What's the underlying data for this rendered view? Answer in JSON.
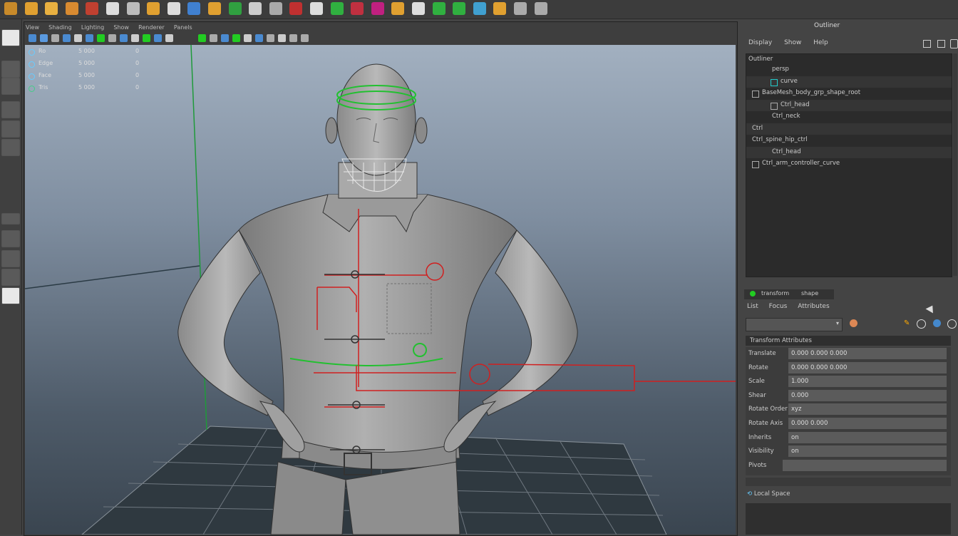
{
  "shelf": {
    "icons": [
      {
        "name": "shelf-icon-1",
        "color": "#c88a2a"
      },
      {
        "name": "shelf-icon-2",
        "color": "#e0a030"
      },
      {
        "name": "shelf-icon-3",
        "color": "#e8b040"
      },
      {
        "name": "shelf-icon-4",
        "color": "#d88a30"
      },
      {
        "name": "shelf-icon-5",
        "color": "#c04030"
      },
      {
        "name": "shelf-icon-6",
        "color": "#ddd"
      },
      {
        "name": "shelf-icon-7",
        "color": "#bbb"
      },
      {
        "name": "shelf-icon-8",
        "color": "#e0a030"
      },
      {
        "name": "shelf-icon-9",
        "color": "#ddd"
      },
      {
        "name": "shelf-icon-10",
        "color": "#4080d0"
      },
      {
        "name": "shelf-icon-11",
        "color": "#e0a030"
      },
      {
        "name": "shelf-icon-12",
        "color": "#30a040"
      },
      {
        "name": "shelf-icon-13",
        "color": "#ccc"
      },
      {
        "name": "shelf-icon-14",
        "color": "#aaa"
      },
      {
        "name": "shelf-icon-15",
        "color": "#c03030"
      },
      {
        "name": "shelf-icon-16",
        "color": "#ddd"
      },
      {
        "name": "shelf-icon-17",
        "color": "#30b040"
      },
      {
        "name": "shelf-icon-18",
        "color": "#c03040"
      },
      {
        "name": "shelf-icon-19",
        "color": "#c02080"
      },
      {
        "name": "shelf-icon-20",
        "color": "#e0a030"
      },
      {
        "name": "shelf-icon-21",
        "color": "#ddd"
      },
      {
        "name": "shelf-icon-22",
        "color": "#30b040"
      },
      {
        "name": "shelf-icon-23",
        "color": "#30b040"
      },
      {
        "name": "shelf-icon-24",
        "color": "#40a0d0"
      },
      {
        "name": "shelf-icon-25",
        "color": "#e0a030"
      },
      {
        "name": "shelf-icon-26",
        "color": "#aaa"
      },
      {
        "name": "shelf-icon-27",
        "color": "#aaa"
      }
    ]
  },
  "viewport": {
    "menu": [
      "View",
      "Shading",
      "Lighting",
      "Show",
      "Renderer",
      "Panels"
    ],
    "hud": [
      {
        "label": "Ro",
        "value": "5 000",
        "value2": "0"
      },
      {
        "label": "Edge",
        "value": "5 000",
        "value2": "0"
      },
      {
        "label": "Face",
        "value": "5 000",
        "value2": "0"
      },
      {
        "label": "Tris",
        "value": "5 000",
        "value2": "0"
      }
    ]
  },
  "right_panel": {
    "title": "Outliner",
    "menu": [
      "Display",
      "Show",
      "Help"
    ],
    "outliner_header": "Outliner",
    "outliner_rows": [
      {
        "text": "persp",
        "indent": 36
      },
      {
        "text": "curve",
        "indent": 36
      },
      {
        "text": "BaseMesh_body_grp_shape_root",
        "indent": 8
      },
      {
        "text": "Ctrl_head",
        "indent": 36
      },
      {
        "text": "Ctrl_neck",
        "indent": 36
      },
      {
        "text": "Ctrl",
        "indent": 8
      },
      {
        "text": "Ctrl_spine_hip_ctrl",
        "indent": 8
      },
      {
        "text": "Ctrl_head",
        "indent": 36
      },
      {
        "text": "Ctrl_arm_controller_curve",
        "indent": 8
      }
    ],
    "attr_tabs": [
      "transform",
      "shape"
    ],
    "attr_menu": [
      "List",
      "Focus",
      "Attributes"
    ],
    "attr_select_value": "",
    "attr_section": "Transform Attributes",
    "attr_rows": [
      {
        "key": "Translate",
        "value": "0.000  0.000  0.000"
      },
      {
        "key": "Rotate",
        "value": "0.000  0.000  0.000"
      },
      {
        "key": "Scale",
        "value": "1.000"
      },
      {
        "key": "Shear",
        "value": "0.000"
      },
      {
        "key": "Rotate Order",
        "value": "xyz"
      },
      {
        "key": "Rotate Axis",
        "value": "0.000  0.000"
      },
      {
        "key": "Inherits",
        "value": "on"
      },
      {
        "key": "Visibility",
        "value": "on"
      },
      {
        "key": "Pivots",
        "value": ""
      }
    ],
    "bottom_label": "Local Space"
  },
  "colors": {
    "control_red": "#d02020",
    "control_green": "#22c030",
    "panel_bg": "#444444"
  }
}
